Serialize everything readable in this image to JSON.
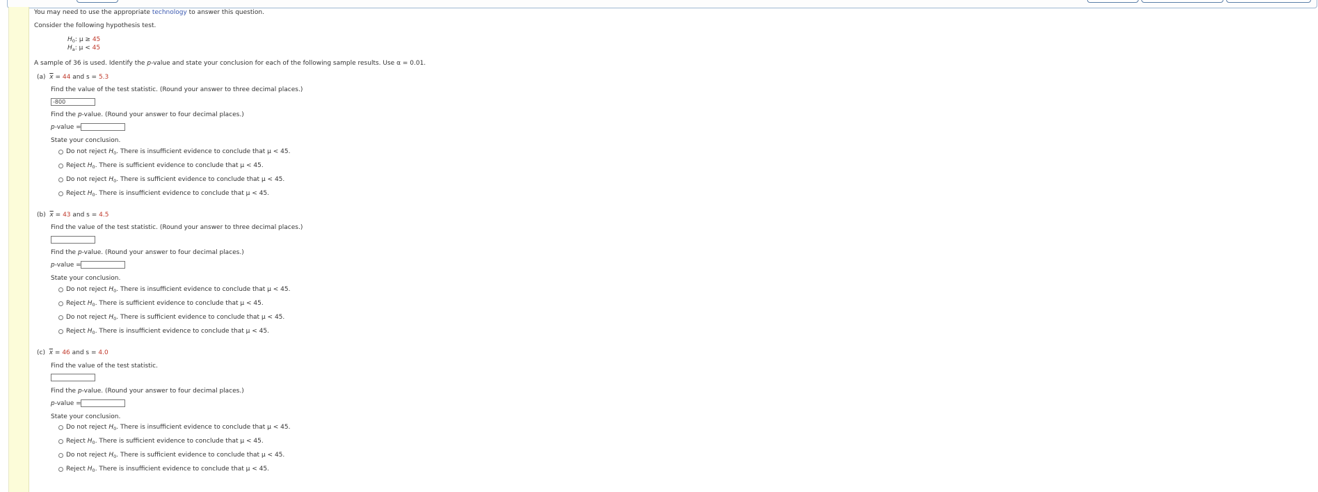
{
  "intro": {
    "technology_prefix": "You may need to use the appropriate ",
    "technology_link": "technology",
    "technology_suffix": " to answer this question.",
    "consider": "Consider the following hypothesis test."
  },
  "hypotheses": {
    "h0_label": "H",
    "h0_sub": "0",
    "h0_rel": ": μ ≥ ",
    "h0_value": "45",
    "ha_label": "H",
    "ha_sub": "a",
    "ha_rel": ": μ < ",
    "ha_value": "45"
  },
  "sample_sentence": {
    "text": "A sample of 36 is used. Identify the ",
    "pvalue_word": "p",
    "text2": "-value and state your conclusion for each of the following sample results. Use ",
    "alpha": "α = 0.01."
  },
  "labels": {
    "find_stat_rounded": "Find the value of the test statistic. (Round your answer to three decimal places.)",
    "find_stat": "Find the value of the test statistic.",
    "find_p_prefix": "Find the ",
    "find_p_p": "p",
    "find_p_suffix": "-value. (Round your answer to four decimal places.)",
    "pvalue_p": "p",
    "pvalue_suffix": "-value =",
    "state_conclusion": "State your conclusion."
  },
  "options": [
    {
      "pre": "Do not reject ",
      "mid": ". There is insufficient evidence to conclude that ",
      "tail": "μ < 45."
    },
    {
      "pre": "Reject ",
      "mid": ". There is sufficient evidence to conclude that ",
      "tail": "μ < 45."
    },
    {
      "pre": "Do not reject ",
      "mid": ". There is sufficient evidence to conclude that ",
      "tail": "μ < 45."
    },
    {
      "pre": "Reject ",
      "mid": ". There is insufficient evidence to conclude that ",
      "tail": "μ < 45."
    }
  ],
  "parts": {
    "a": {
      "letter": "(a)",
      "xbar": "x",
      "eq": " = ",
      "xval": "44",
      "and_s": " and s = ",
      "sval": "5.3",
      "stat_value": "-800",
      "pvalue_value": ""
    },
    "b": {
      "letter": "(b)",
      "xbar": "x",
      "eq": " = ",
      "xval": "43",
      "and_s": " and s = ",
      "sval": "4.5",
      "stat_value": "",
      "pvalue_value": ""
    },
    "c": {
      "letter": "(c)",
      "xbar": "x",
      "eq": " = ",
      "xval": "46",
      "and_s": " and s = ",
      "sval": "4.0",
      "stat_value": "",
      "pvalue_value": ""
    }
  }
}
